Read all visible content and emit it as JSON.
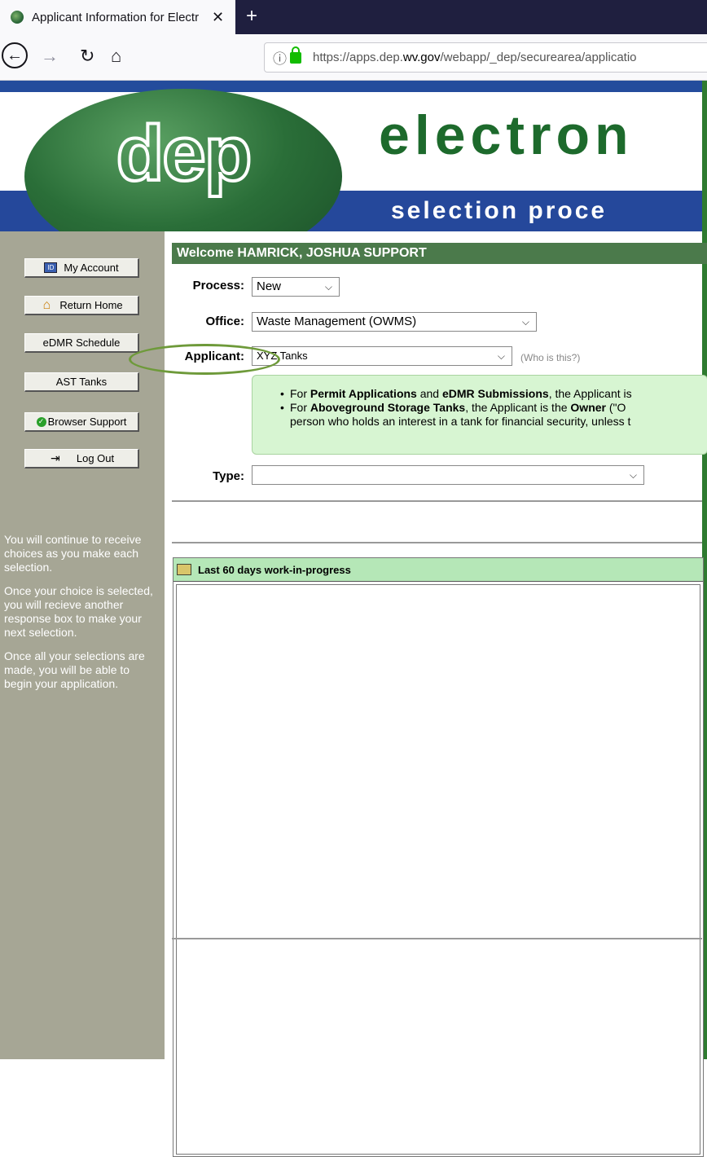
{
  "browser": {
    "tab_title": "Applicant Information for Electr",
    "tab_close": "✕",
    "new_tab": "+",
    "url_domain_prefix": "https://apps.dep.",
    "url_domain": "wv.gov",
    "url_path": "/webapp/_dep/securearea/applicatio"
  },
  "banner": {
    "logo_text": "dep",
    "title": "electron",
    "subtitle": "selection proce"
  },
  "sidebar": {
    "buttons": [
      {
        "label": "My Account",
        "icon": "account-card-icon"
      },
      {
        "label": "Return Home",
        "icon": "house-icon"
      },
      {
        "label": "eDMR Schedule",
        "icon": ""
      },
      {
        "label": "AST Tanks",
        "icon": ""
      },
      {
        "label": "Browser Support",
        "icon": "check-circle-icon"
      },
      {
        "label": "Log Out",
        "icon": "door-exit-icon"
      }
    ],
    "help": [
      "You will continue to receive choices as you make each selection.",
      "Once your choice is selected, you will recieve another response box to make your next selection.",
      "Once all your selections are made, you will be able to begin your application."
    ]
  },
  "main": {
    "welcome": "Welcome HAMRICK, JOSHUA SUPPORT",
    "process": {
      "label": "Process:",
      "value": "New"
    },
    "office": {
      "label": "Office:",
      "value": "Waste Management (OWMS)"
    },
    "applicant": {
      "label": "Applicant:",
      "value": "XYZ Tanks",
      "help_link": "(Who is this?)"
    },
    "info": {
      "line1_pre": "For ",
      "line1_b1": "Permit Applications",
      "line1_mid": " and ",
      "line1_b2": "eDMR Submissions",
      "line1_post": ", the Applicant is",
      "line2_pre": "For ",
      "line2_b1": "Aboveground Storage Tanks",
      "line2_mid": ", the Applicant is the ",
      "line2_b2": "Owner",
      "line2_post": " (\"O",
      "line3": "person who holds an interest in a tank for financial security, unless t"
    },
    "type": {
      "label": "Type:",
      "value": ""
    },
    "wip_title": "Last 60 days work-in-progress"
  },
  "colors": {
    "welcome_bg": "#4b7a4b",
    "sidebar_bg": "#a6a695",
    "info_bg": "#d7f5d2",
    "wip_header_bg": "#b5e7b7",
    "banner_blue": "#25489b",
    "banner_green": "#1d6a2c"
  }
}
